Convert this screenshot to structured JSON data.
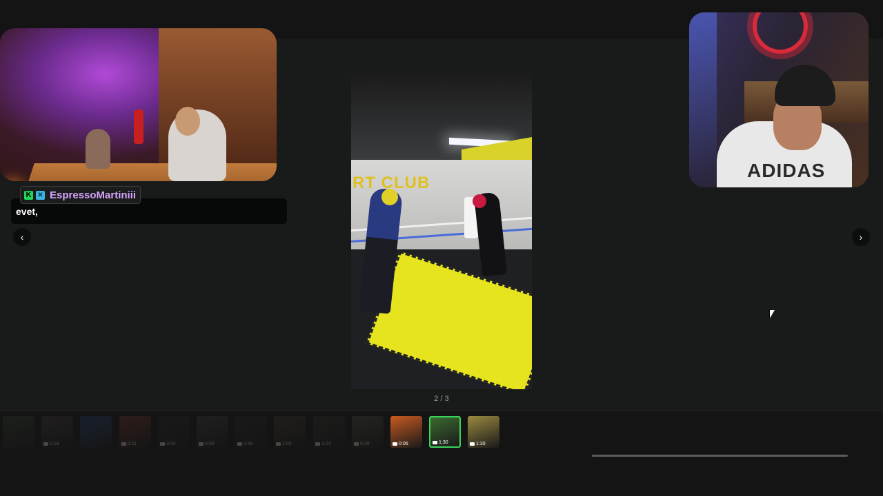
{
  "chat": {
    "username": "EspressoMartiniii",
    "badge_k_label": "K",
    "badge_x_label": "✕",
    "message": "evet,"
  },
  "viewer": {
    "counter": "2 / 3",
    "prev_label": "‹",
    "next_label": "›"
  },
  "media": {
    "wall_sign": "RT  CLUB"
  },
  "right_cam": {
    "shirt_text": "ADIDAS"
  },
  "thumbnails": [
    {
      "duration": "",
      "color": "#3a4a38",
      "state": "dim"
    },
    {
      "duration": "0:18",
      "color": "#4a4440",
      "state": "dim"
    },
    {
      "duration": "",
      "color": "#2a4a8a",
      "state": "dim"
    },
    {
      "duration": "0:11",
      "color": "#8a3a30",
      "state": "dim"
    },
    {
      "duration": "3:00",
      "color": "#2a2a2a",
      "state": "dim"
    },
    {
      "duration": "3:00",
      "color": "#4a4848",
      "state": "dim"
    },
    {
      "duration": "0:48",
      "color": "#2a2a2a",
      "state": "dim"
    },
    {
      "duration": "2:00",
      "color": "#4a4230",
      "state": "dim"
    },
    {
      "duration": "1:23",
      "color": "#3a3630",
      "state": "dim"
    },
    {
      "duration": "0:39",
      "color": "#5a6048",
      "state": "dim"
    },
    {
      "duration": "0:06",
      "color": "#c85a20",
      "state": "normal"
    },
    {
      "duration": "1:30",
      "color": "#3a6a30",
      "state": "active"
    },
    {
      "duration": "1:30",
      "color": "#9a8a40",
      "state": "normal"
    }
  ]
}
